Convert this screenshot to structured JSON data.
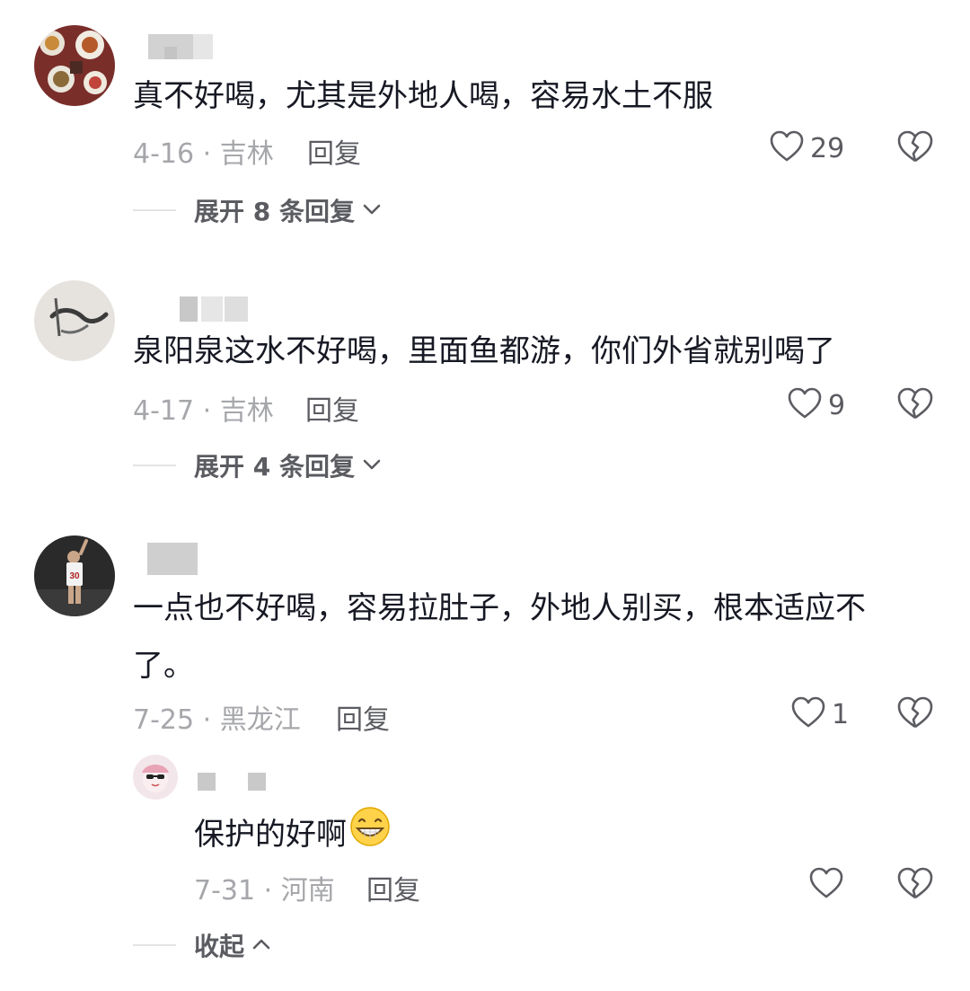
{
  "comments": [
    {
      "text": "真不好喝，尤其是外地人喝，容易水土不服",
      "date_loc": "4-16 · 吉林",
      "reply_label": "回复",
      "likes": "29",
      "expand_label": "展开 8 条回复"
    },
    {
      "text": "泉阳泉这水不好喝，里面鱼都游，你们外省就别喝了",
      "date_loc": "4-17 · 吉林",
      "reply_label": "回复",
      "likes": "9",
      "expand_label": "展开 4 条回复"
    },
    {
      "text_line1": "一点也不好喝，容易拉肚子，外地人别买，根本适应不",
      "text_line2": "了。",
      "date_loc": "7-25 · 黑龙江",
      "reply_label": "回复",
      "likes": "1",
      "reply": {
        "text": "保护的好啊",
        "emoji": "grinning-face",
        "date_loc": "7-31 · 河南",
        "reply_label": "回复",
        "likes": ""
      },
      "collapse_label": "收起"
    }
  ],
  "colors": {
    "text": "#161823",
    "meta": "#a6a7ab",
    "action": "#5b5c61",
    "blur": "#d8d8d8"
  }
}
